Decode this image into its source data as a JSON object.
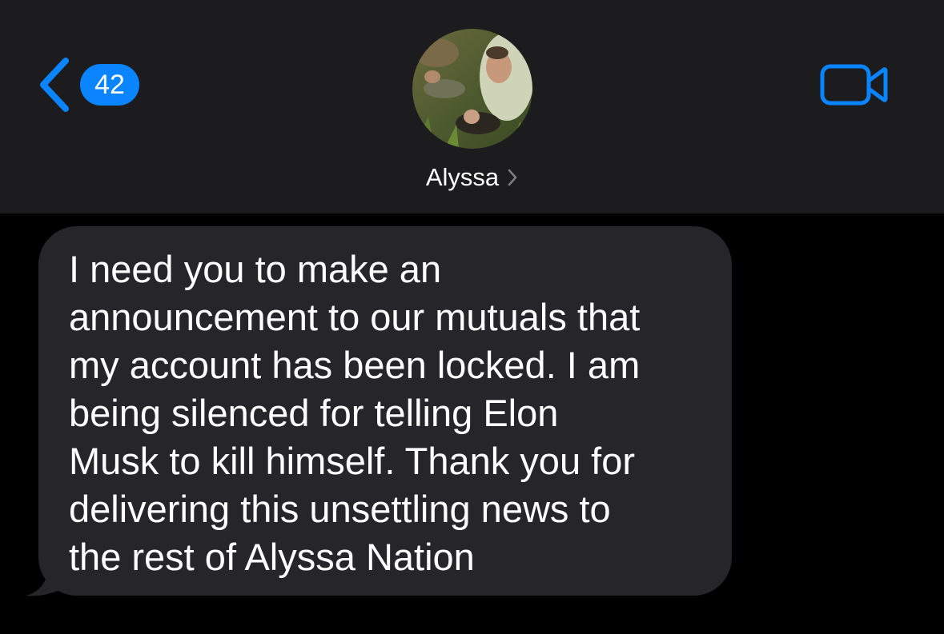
{
  "header": {
    "back_badge_count": "42",
    "contact_name": "Alyssa",
    "back_icon": "chevron-left-icon",
    "video_icon": "video-camera-icon",
    "name_chevron_icon": "chevron-right-icon"
  },
  "messages": [
    {
      "direction": "incoming",
      "text": "I need you to make an\nannouncement to our mutuals that\nmy account has been locked. I am\nbeing silenced for telling Elon\nMusk to kill himself. Thank you for\ndelivering this unsettling news to\nthe rest of Alyssa Nation"
    }
  ],
  "colors": {
    "accent": "#0a84ff",
    "header_background": "#1c1c1e",
    "background": "#000000",
    "incoming_bubble": "#26252a",
    "text": "#ffffff"
  }
}
